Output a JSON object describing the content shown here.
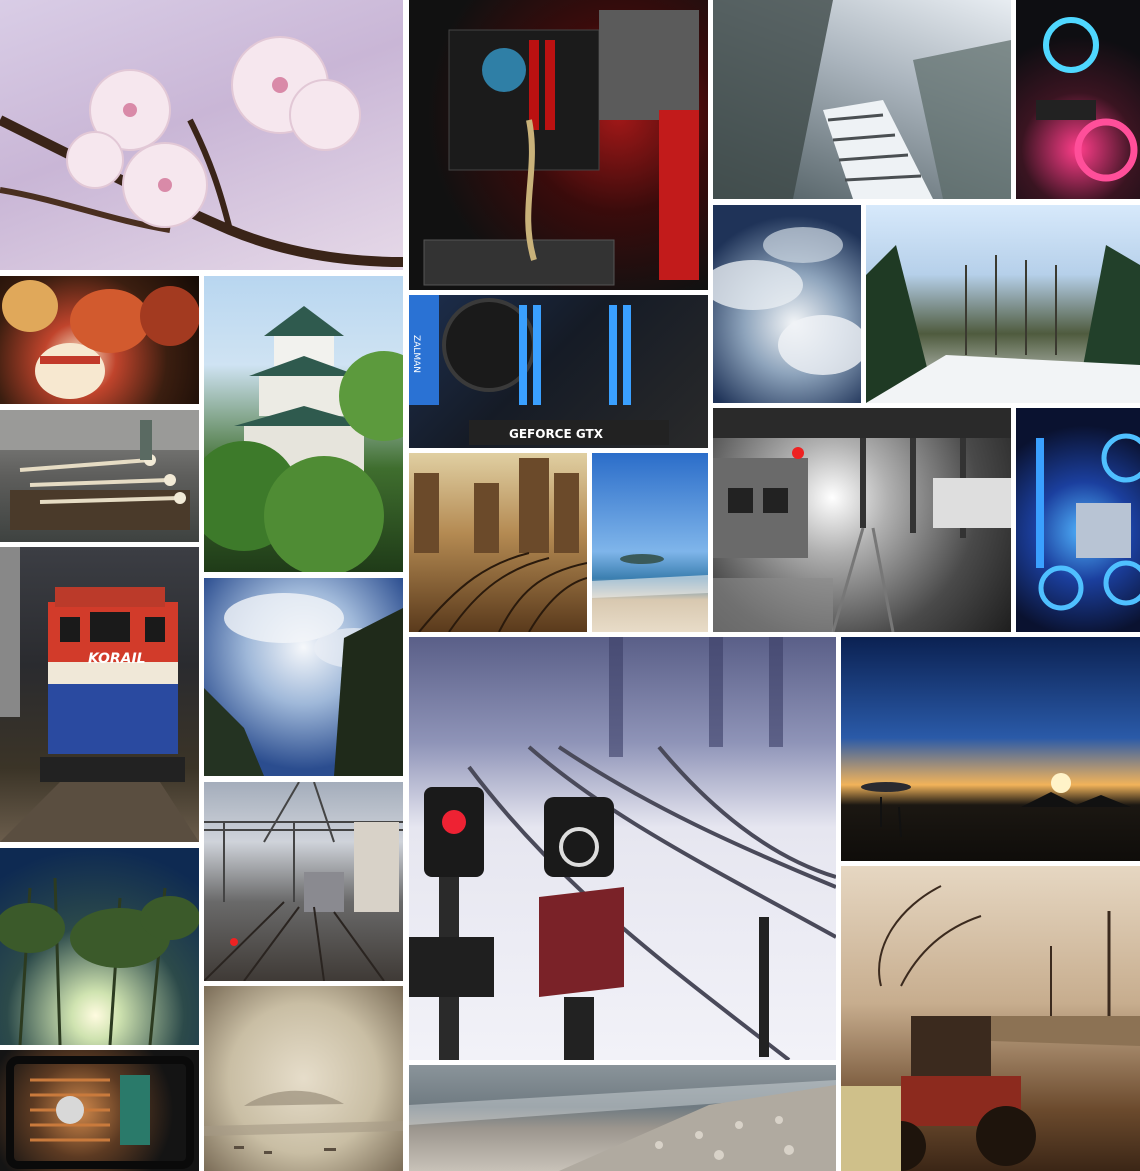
{
  "collage": {
    "tiles": [
      {
        "id": "t1",
        "subject": "cherry-blossom"
      },
      {
        "id": "t2",
        "subject": "pc-interior-red"
      },
      {
        "id": "t3",
        "subject": "snowy-stairs"
      },
      {
        "id": "t4",
        "subject": "pc-interior-pink"
      },
      {
        "id": "t5",
        "subject": "paper-lanterns"
      },
      {
        "id": "t6",
        "subject": "castle"
      },
      {
        "id": "t7",
        "subject": "pc-interior-zalman",
        "labels": [
          "ZALMAN",
          "GEFORCE GTX"
        ]
      },
      {
        "id": "t8",
        "subject": "cloudy-sky"
      },
      {
        "id": "t9",
        "subject": "snowy-trees"
      },
      {
        "id": "t10",
        "subject": "water-ladles"
      },
      {
        "id": "t11",
        "subject": "railway-tracks-sepia"
      },
      {
        "id": "t12",
        "subject": "beach-island"
      },
      {
        "id": "t13",
        "subject": "train-station-bw"
      },
      {
        "id": "t14",
        "subject": "pc-interior-blue"
      },
      {
        "id": "t15",
        "subject": "korail-locomotive",
        "labels": [
          "KORAIL"
        ]
      },
      {
        "id": "t16",
        "subject": "trees-and-sky"
      },
      {
        "id": "t17",
        "subject": "snowy-railway-signals"
      },
      {
        "id": "t18",
        "subject": "sunset-beach"
      },
      {
        "id": "t19",
        "subject": "railway-catenary"
      },
      {
        "id": "t20",
        "subject": "bamboo-sun"
      },
      {
        "id": "t21",
        "subject": "tractor-sepia"
      },
      {
        "id": "t22",
        "subject": "hazy-harbor"
      },
      {
        "id": "t23",
        "subject": "pc-interior-copper"
      },
      {
        "id": "t24",
        "subject": "pebble-beach"
      }
    ]
  }
}
